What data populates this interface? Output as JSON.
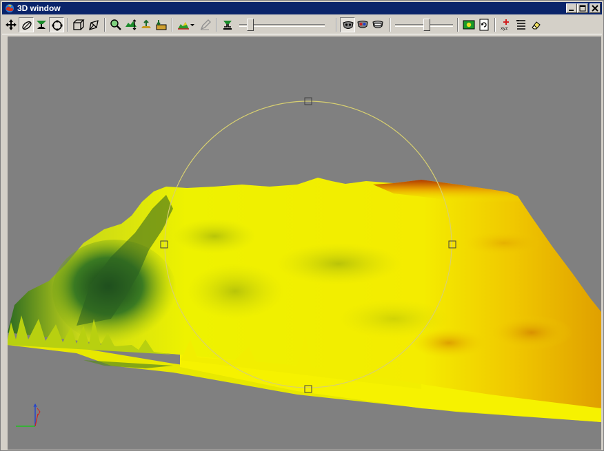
{
  "window": {
    "title": "3D window"
  },
  "toolbar": {
    "sliders": [
      {
        "name": "zoom-slider",
        "value": 0.1
      },
      {
        "name": "lighting-slider",
        "value": 0.55
      }
    ]
  },
  "colors": {
    "titlebar": "#0a246a",
    "viewport_bg": "#808080",
    "surface_low": "#1f5a1f",
    "surface_mid": "#e8f000",
    "surface_high": "#b84a00",
    "handle_circle": "#d8d070"
  }
}
